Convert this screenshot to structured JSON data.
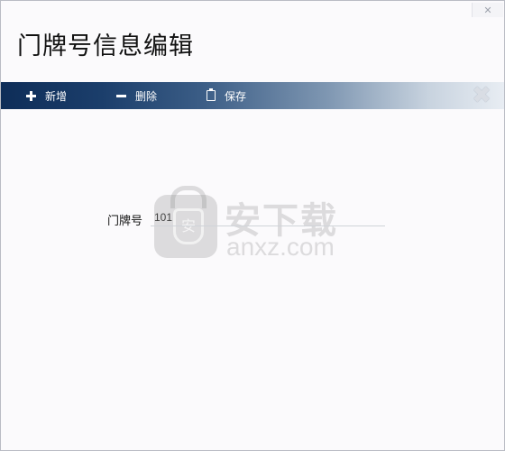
{
  "window": {
    "title": "门牌号信息编辑",
    "close_glyph": "✕"
  },
  "toolbar": {
    "add_label": "新增",
    "delete_label": "删除",
    "save_label": "保存",
    "close_glyph": "✖"
  },
  "form": {
    "house_number_label": "门牌号",
    "house_number_value": "101"
  },
  "watermark": {
    "text_cn": "安下载",
    "text_en": "anxz.com",
    "shield_glyph": "安"
  },
  "colors": {
    "toolbar_dark": "#0e2d58",
    "toolbar_light": "#e8edf3",
    "background": "#fbfafc"
  }
}
